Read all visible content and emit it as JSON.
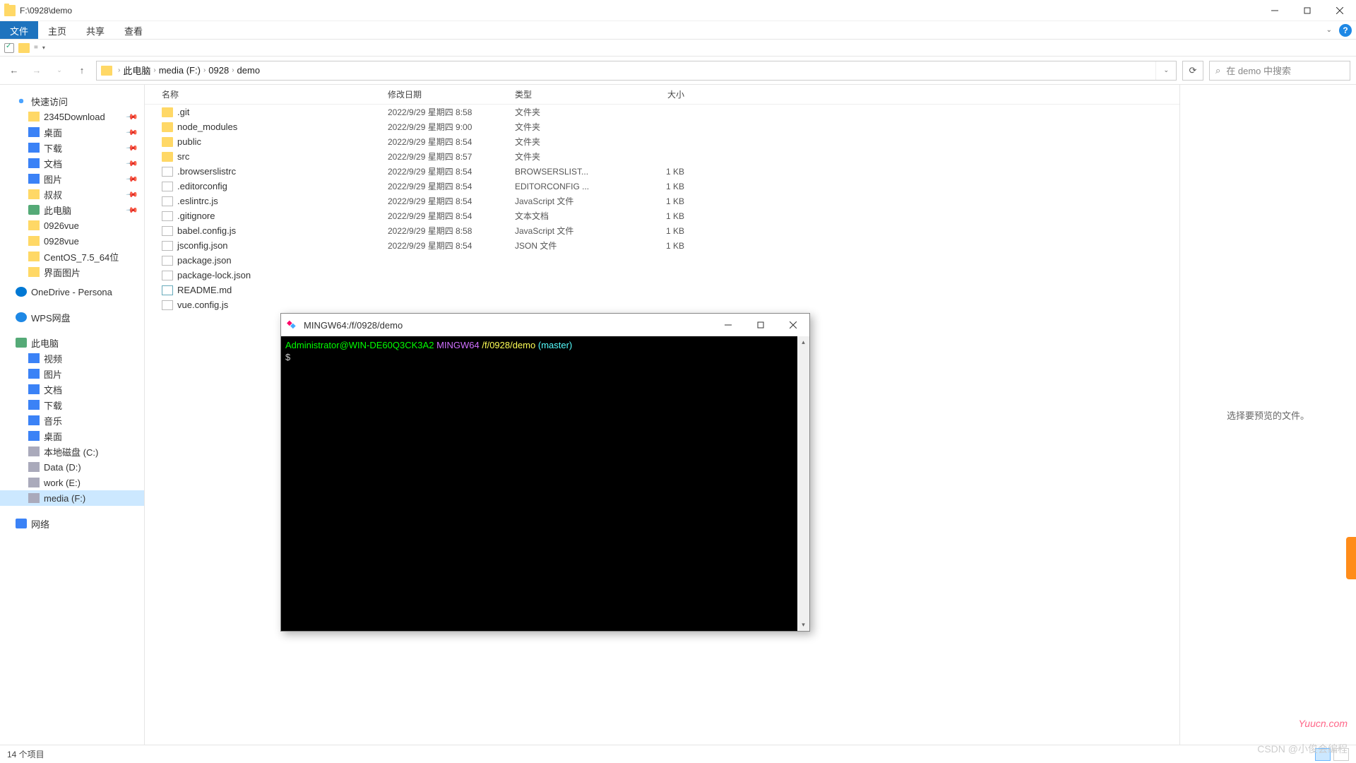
{
  "window": {
    "title": "F:\\0928\\demo",
    "minimize_tooltip": "最小化",
    "maximize_tooltip": "最大化",
    "close_tooltip": "关闭"
  },
  "ribbon": {
    "file": "文件",
    "home": "主页",
    "share": "共享",
    "view": "查看",
    "help": "?"
  },
  "nav": {
    "back": "←",
    "forward": "→",
    "up": "↑"
  },
  "breadcrumb": {
    "items": [
      "此电脑",
      "media (F:)",
      "0928",
      "demo"
    ]
  },
  "search": {
    "icon": "🔍",
    "placeholder": "在 demo 中搜索"
  },
  "sidebar": {
    "quick_access": "快速访问",
    "items_pinned": [
      {
        "icon": "ic-folder",
        "label": "2345Download",
        "pinned": true
      },
      {
        "icon": "ic-desktop",
        "label": "桌面",
        "pinned": true
      },
      {
        "icon": "ic-download",
        "label": "下载",
        "pinned": true
      },
      {
        "icon": "ic-doc",
        "label": "文档",
        "pinned": true
      },
      {
        "icon": "ic-pic",
        "label": "图片",
        "pinned": true
      },
      {
        "icon": "ic-user",
        "label": "叔叔",
        "pinned": true
      },
      {
        "icon": "ic-pc",
        "label": "此电脑",
        "pinned": true
      },
      {
        "icon": "ic-folder",
        "label": "0926vue",
        "pinned": false
      },
      {
        "icon": "ic-folder",
        "label": "0928vue",
        "pinned": false
      },
      {
        "icon": "ic-folder",
        "label": "CentOS_7.5_64位",
        "pinned": false
      },
      {
        "icon": "ic-folder",
        "label": "界面图片",
        "pinned": false
      }
    ],
    "onedrive": "OneDrive - Persona",
    "wps": "WPS网盘",
    "thispc": "此电脑",
    "pc_items": [
      {
        "icon": "ic-video",
        "label": "视频"
      },
      {
        "icon": "ic-pic",
        "label": "图片"
      },
      {
        "icon": "ic-doc",
        "label": "文档"
      },
      {
        "icon": "ic-download",
        "label": "下载"
      },
      {
        "icon": "ic-music",
        "label": "音乐"
      },
      {
        "icon": "ic-desktop",
        "label": "桌面"
      },
      {
        "icon": "ic-drive",
        "label": "本地磁盘 (C:)"
      },
      {
        "icon": "ic-drive",
        "label": "Data (D:)"
      },
      {
        "icon": "ic-drive",
        "label": "work (E:)"
      },
      {
        "icon": "ic-drive",
        "label": "media (F:)",
        "selected": true
      }
    ],
    "network": "网络"
  },
  "columns": {
    "name": "名称",
    "date": "修改日期",
    "type": "类型",
    "size": "大小"
  },
  "files": [
    {
      "icon": "fic-folder",
      "name": ".git",
      "date": "2022/9/29 星期四 8:58",
      "type": "文件夹",
      "size": ""
    },
    {
      "icon": "fic-folder",
      "name": "node_modules",
      "date": "2022/9/29 星期四 9:00",
      "type": "文件夹",
      "size": ""
    },
    {
      "icon": "fic-folder",
      "name": "public",
      "date": "2022/9/29 星期四 8:54",
      "type": "文件夹",
      "size": ""
    },
    {
      "icon": "fic-folder",
      "name": "src",
      "date": "2022/9/29 星期四 8:57",
      "type": "文件夹",
      "size": ""
    },
    {
      "icon": "fic-file",
      "name": ".browserslistrc",
      "date": "2022/9/29 星期四 8:54",
      "type": "BROWSERSLIST...",
      "size": "1 KB"
    },
    {
      "icon": "fic-file",
      "name": ".editorconfig",
      "date": "2022/9/29 星期四 8:54",
      "type": "EDITORCONFIG ...",
      "size": "1 KB"
    },
    {
      "icon": "fic-js",
      "name": ".eslintrc.js",
      "date": "2022/9/29 星期四 8:54",
      "type": "JavaScript 文件",
      "size": "1 KB"
    },
    {
      "icon": "fic-file",
      "name": ".gitignore",
      "date": "2022/9/29 星期四 8:54",
      "type": "文本文档",
      "size": "1 KB"
    },
    {
      "icon": "fic-js",
      "name": "babel.config.js",
      "date": "2022/9/29 星期四 8:58",
      "type": "JavaScript 文件",
      "size": "1 KB"
    },
    {
      "icon": "fic-file",
      "name": "jsconfig.json",
      "date": "2022/9/29 星期四 8:54",
      "type": "JSON 文件",
      "size": "1 KB"
    },
    {
      "icon": "fic-file",
      "name": "package.json",
      "date": "",
      "type": "",
      "size": ""
    },
    {
      "icon": "fic-file",
      "name": "package-lock.json",
      "date": "",
      "type": "",
      "size": ""
    },
    {
      "icon": "fic-md",
      "name": "README.md",
      "date": "",
      "type": "",
      "size": ""
    },
    {
      "icon": "fic-js",
      "name": "vue.config.js",
      "date": "",
      "type": "",
      "size": ""
    }
  ],
  "preview": {
    "empty_text": "选择要预览的文件。"
  },
  "statusbar": {
    "item_count": "14 个项目"
  },
  "terminal": {
    "title": "MINGW64:/f/0928/demo",
    "prompt_user": "Administrator@WIN-DE60Q3CK3A2",
    "prompt_env": "MINGW64",
    "prompt_path": "/f/0928/demo",
    "prompt_branch": "(master)",
    "prompt_symbol": "$"
  },
  "watermark1": "Yuucn.com",
  "watermark2": "CSDN @小俊会编程"
}
